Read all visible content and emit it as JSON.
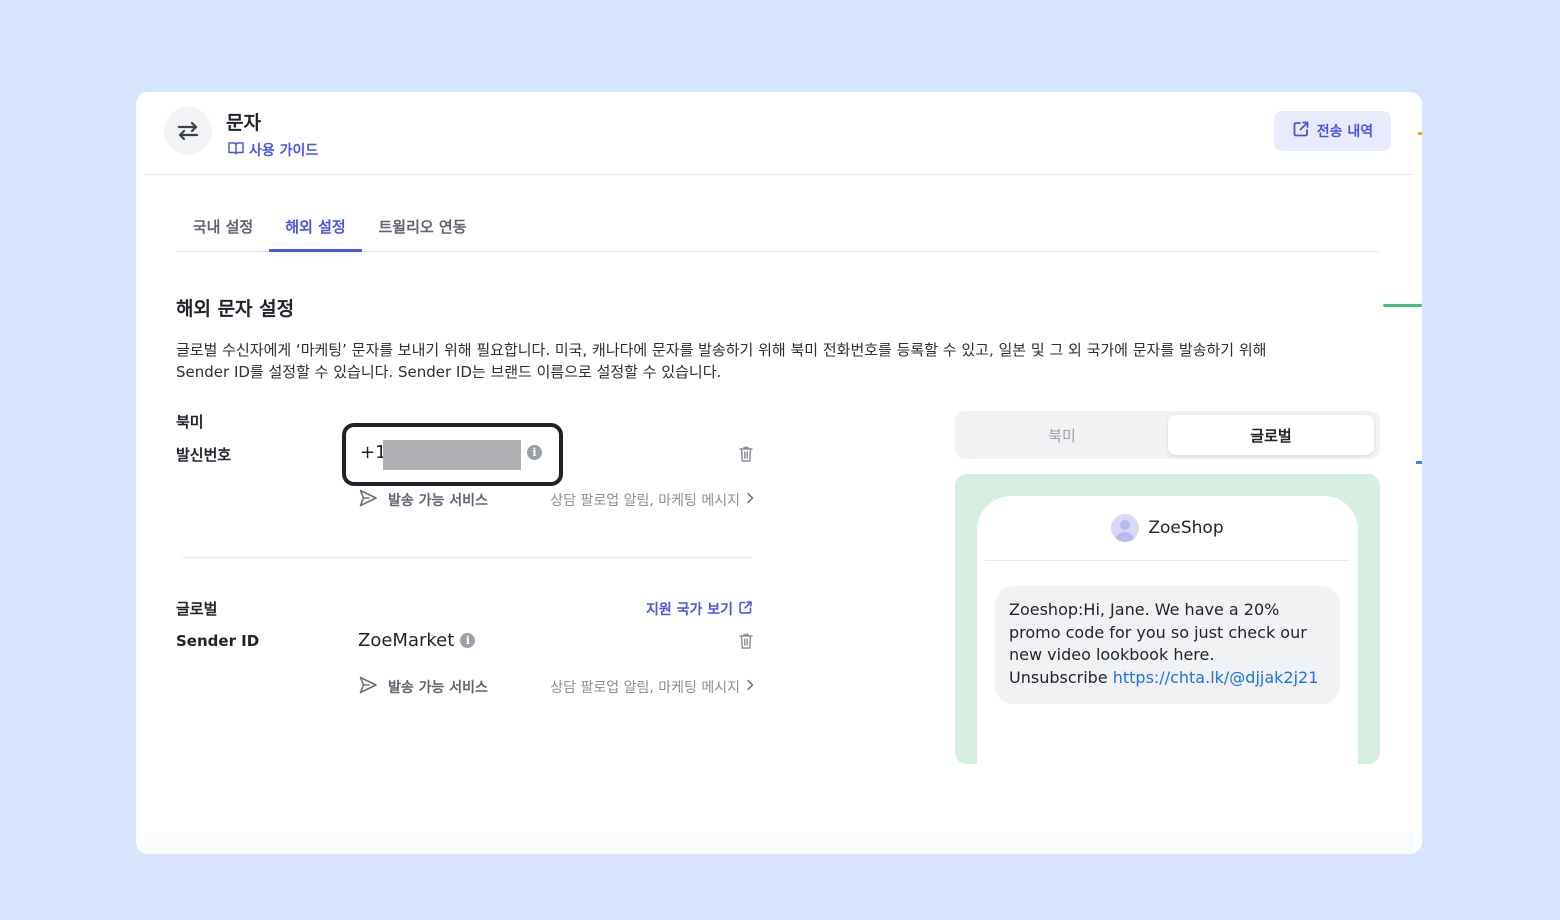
{
  "header": {
    "title": "문자",
    "guide_label": "사용 가이드",
    "history_label": "전송 내역"
  },
  "tabs": [
    {
      "label": "국내 설정",
      "active": false
    },
    {
      "label": "해외 설정",
      "active": true
    },
    {
      "label": "트윌리오 연동",
      "active": false
    }
  ],
  "section": {
    "title": "해외 문자 설정",
    "description_line1": "글로벌 수신자에게 ‘마케팅’ 문자를 보내기 위해 필요합니다. 미국, 캐나다에 문자를 발송하기 위해 북미 전화번호를 등록할 수 있고, 일본 및 그 외 국가에 문자를 발송하기 위해",
    "description_line2": "Sender ID를 설정할 수 있습니다. Sender ID는 브랜드 이름으로 설정할 수 있습니다."
  },
  "north_america": {
    "group_label": "북미",
    "field_label": "발신번호",
    "phone_prefix": "+1",
    "service_label": "발송 가능 서비스",
    "service_value": "상담 팔로업 알림, 마케팅 메시지"
  },
  "global": {
    "group_label": "글로벌",
    "field_label": "Sender ID",
    "support_link": "지원 국가 보기",
    "sender_id": "ZoeMarket",
    "service_label": "발송 가능 서비스",
    "service_value": "상담 팔로업 알림, 마케팅 메시지"
  },
  "preview": {
    "toggle": [
      {
        "label": "북미",
        "selected": false
      },
      {
        "label": "글로벌",
        "selected": true
      }
    ],
    "shop_name": "ZoeShop",
    "message_line1": "Zoeshop:Hi, Jane. We have a 20%",
    "message_line2": "promo code for you so just check our",
    "message_line3": "new video lookbook here.",
    "message_unsub": "Unsubscribe",
    "message_link": "https://chta.lk/@djjak2j21"
  },
  "colors": {
    "page_bg": "#d6e4fd",
    "accent": "#4a55e6",
    "preview_bg": "#d6eee1",
    "link": "#1a73e8"
  }
}
